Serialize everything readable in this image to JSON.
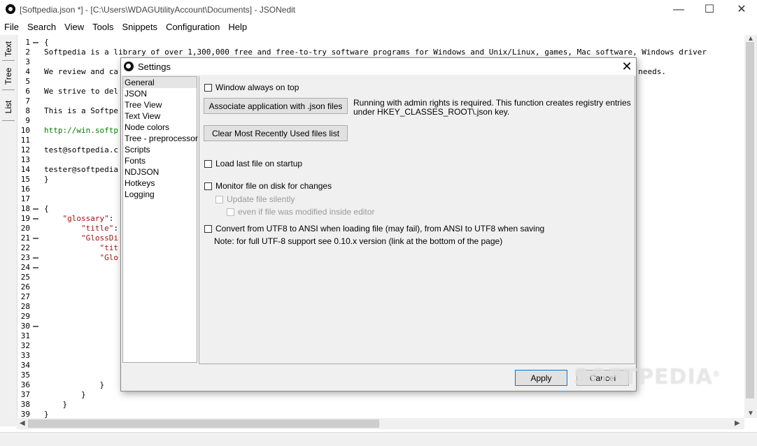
{
  "window": {
    "title": "[Softpedia.json *] - [C:\\Users\\WDAGUtilityAccount\\Documents] - JSONedit",
    "minimize": "—",
    "maximize": "☐",
    "close": "✕"
  },
  "menu": [
    "File",
    "Search",
    "View",
    "Tools",
    "Snippets",
    "Configuration",
    "Help"
  ],
  "side_tabs": [
    "Text",
    "Tree",
    "List"
  ],
  "editor": {
    "line_numbers": [
      "1",
      "2",
      "3",
      "4",
      "5",
      "6",
      "7",
      "8",
      "9",
      "10",
      "11",
      "12",
      "13",
      "14",
      "15",
      "16",
      "17",
      "18",
      "19",
      "20",
      "21",
      "22",
      "23",
      "24",
      "25",
      "26",
      "27",
      "28",
      "29",
      "30",
      "31",
      "32",
      "33",
      "34",
      "35",
      "36",
      "37",
      "38",
      "39"
    ],
    "lines": [
      "{",
      "Softpedia is a library of over 1,300,000 free and free-to-try software programs for Windows and Unix/Linux, games, Mac software, Windows driver",
      "",
      "We review and ca",
      "",
      "We strive to del",
      "",
      "This is a Softpe",
      "",
      "http://win.softp",
      "",
      "test@softpedia.c",
      "",
      "tester@softpedia",
      "}",
      "",
      "",
      "{",
      "    \"glossary\":",
      "        \"title\":",
      "        \"GlossDi",
      "            \"tit",
      "            \"Glo",
      "",
      "",
      "",
      "",
      "",
      "",
      "",
      "",
      "",
      "",
      "",
      "",
      "            }",
      "        }",
      "    }",
      "}"
    ],
    "line4_tail": "m needs."
  },
  "dialog": {
    "title": "Settings",
    "close": "✕",
    "nav": [
      "General",
      "JSON",
      "Tree View",
      "Text View",
      "Node colors",
      "Tree - preprocessor",
      "Scripts",
      "Fonts",
      "NDJSON",
      "Hotkeys",
      "Logging"
    ],
    "selected_nav": "General",
    "window_on_top": "Window always on top",
    "associate_button": "Associate application with .json files",
    "admin_note_1": "Running with admin rights is required. This function creates registry entries",
    "admin_note_2": "under HKEY_CLASSES_ROOT\\.json key.",
    "clear_mru_button": "Clear Most Recently Used files list",
    "load_last": "Load last file on startup",
    "monitor_file": "Monitor file on disk for changes",
    "update_silently": "Update file silently",
    "even_if_modified": "even if file was modified inside editor",
    "convert_utf8": "Convert from UTF8 to ANSI when loading file (may fail), from ANSI to UTF8 when saving",
    "utf8_note": "Note: for full UTF-8 support see 0.10.x version (link at the bottom of the page)",
    "apply": "Apply",
    "cancel": "Cancel"
  },
  "watermark": "SOFTPEDIA",
  "watermark_mark": "®",
  "colors": {
    "string": "#a31515",
    "url": "#008000",
    "dialog_bg": "#f0f0f0",
    "accent": "#0078d7"
  }
}
